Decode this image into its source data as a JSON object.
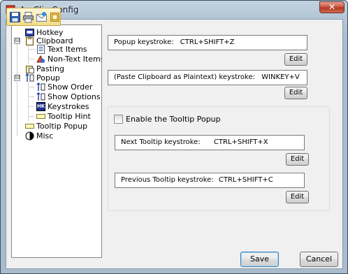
{
  "window": {
    "title": "ArcClip Config",
    "close_glyph": "✕"
  },
  "quick_toolbar": {
    "icons": [
      "save-icon",
      "print-icon",
      "email-icon",
      "export-icon"
    ]
  },
  "tree": {
    "items": [
      {
        "label": "Hotkey",
        "icon": "hotkey-icon"
      },
      {
        "label": "Clipboard",
        "icon": "clipboard-icon",
        "expander": "⊟"
      },
      {
        "label": "Text Items",
        "icon": "text-items-icon"
      },
      {
        "label": "Non-Text Items",
        "icon": "non-text-items-icon"
      },
      {
        "label": "Pasting",
        "icon": "pasting-icon"
      },
      {
        "label": "Popup",
        "icon": "popup-icon",
        "expander": "⊟"
      },
      {
        "label": "Show Order",
        "icon": "sort-icon"
      },
      {
        "label": "Show Options",
        "icon": "sort-icon"
      },
      {
        "label": "Keystrokes",
        "icon": "keyboard-icon",
        "icon_text": "HK"
      },
      {
        "label": "Tooltip Hint",
        "icon": "tooltip-icon"
      },
      {
        "label": "Tooltip Popup",
        "icon": "tooltip-popup-icon"
      },
      {
        "label": "Misc",
        "icon": "misc-icon"
      }
    ]
  },
  "popup_keystroke": {
    "label": "Popup keystroke:",
    "value": "CTRL+SHIFT+Z",
    "edit_label": "Edit"
  },
  "plaintext_keystroke": {
    "label": "(Paste Clipboard as Plaintext) keystroke:",
    "value": "WINKEY+V",
    "edit_label": "Edit"
  },
  "tooltip_group": {
    "enable_label": "Enable the Tooltip Popup",
    "enabled": false,
    "next": {
      "label": "Next Tooltip keystroke:",
      "value": "CTRL+SHIFT+X",
      "edit_label": "Edit"
    },
    "previous": {
      "label": "Previous Tooltip keystroke:",
      "value": "CTRL+SHIFT+C",
      "edit_label": "Edit"
    }
  },
  "footer": {
    "save_label": "Save",
    "cancel_label": "Cancel"
  },
  "colors": {
    "title_bar": "#b4c6d6",
    "close_button": "#c8503d",
    "quick_toolbar": "#f1dd8a",
    "client_bg": "#f0f0f0"
  }
}
